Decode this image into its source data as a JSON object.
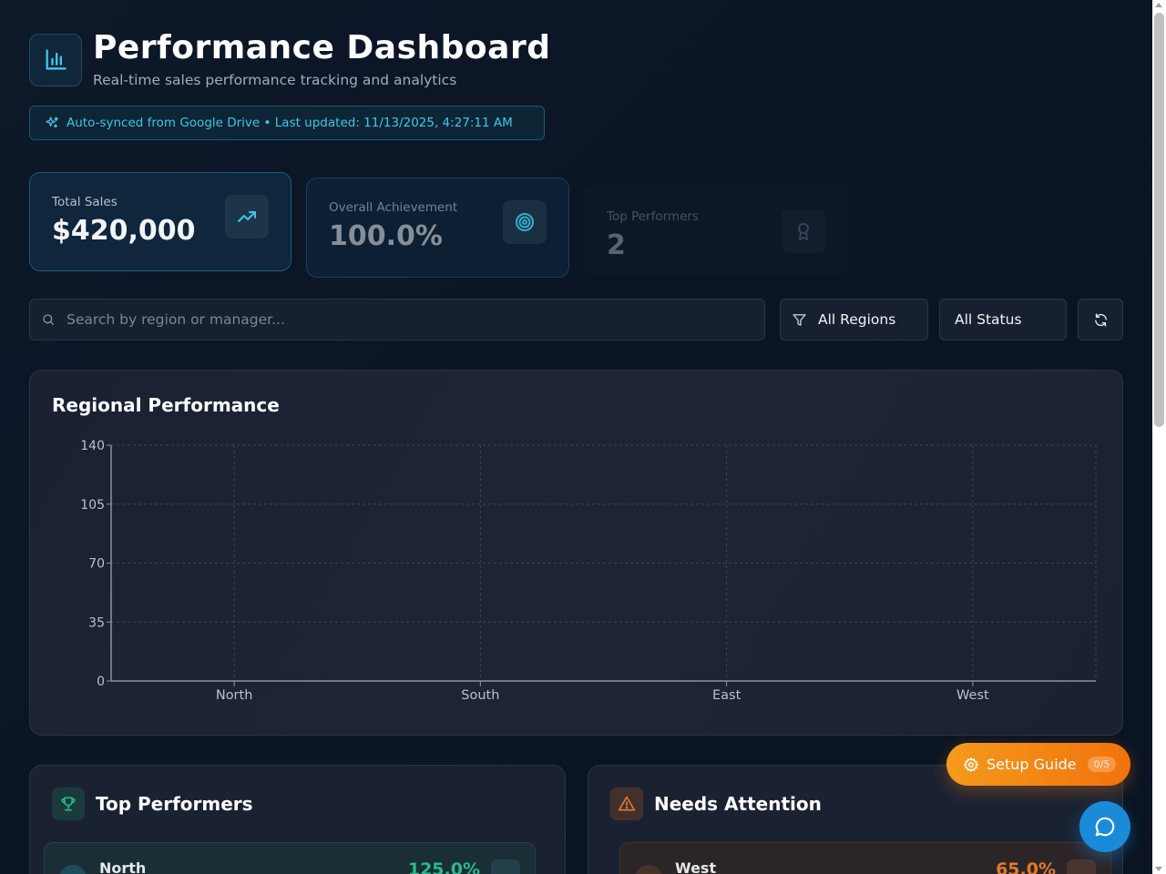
{
  "header": {
    "title": "Performance Dashboard",
    "subtitle": "Real-time sales performance tracking and analytics",
    "logo_icon": "bar-chart-icon"
  },
  "sync": {
    "icon": "sparkles-icon",
    "text": "Auto-synced from Google Drive • Last updated: 11/13/2025, 4:27:11 AM"
  },
  "stats": [
    {
      "label": "Total Sales",
      "value": "$420,000",
      "icon": "trending-up-icon"
    },
    {
      "label": "Overall Achievement",
      "value": "100.0%",
      "icon": "target-icon"
    },
    {
      "label": "Top Performers",
      "value": "2",
      "icon": "award-icon"
    }
  ],
  "filters": {
    "search_placeholder": "Search by region or manager...",
    "search_value": "",
    "region_selected": "All Regions",
    "status_selected": "All Status",
    "refresh_icon": "refresh-icon"
  },
  "chart_panel": {
    "title": "Regional Performance"
  },
  "chart_data": {
    "type": "bar",
    "categories": [
      "North",
      "South",
      "East",
      "West"
    ],
    "series": [],
    "y_ticks": [
      0,
      35,
      70,
      105,
      140
    ],
    "ylim": [
      0,
      140
    ],
    "grid": true,
    "xlabel": "",
    "ylabel": ""
  },
  "top_performers": {
    "title": "Top Performers",
    "icon": "trophy-icon",
    "rows": [
      {
        "name": "North",
        "value": "125.0%"
      }
    ]
  },
  "needs_attention": {
    "title": "Needs Attention",
    "icon": "alert-triangle-icon",
    "rows": [
      {
        "name": "West",
        "value": "65.0%"
      }
    ]
  },
  "floating": {
    "setup_label": "Setup Guide",
    "setup_count": "0/5",
    "chat_icon": "chat-bubble-icon"
  },
  "colors": {
    "accent_cyan": "#3fc6e8",
    "success_green": "#2ab98b",
    "warning_orange": "#e07a2a",
    "setup_orange": "#f2720c",
    "chat_blue": "#1b8ad9"
  }
}
